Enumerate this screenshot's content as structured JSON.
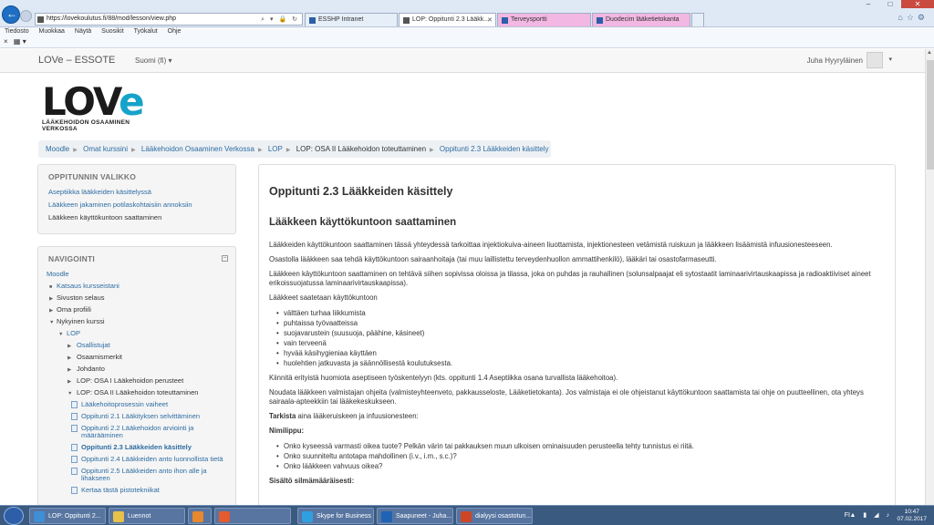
{
  "browser": {
    "url": "https://lovekoulutus.fi/88/mod/lesson/view.php",
    "tabs": [
      {
        "label": "ESSHP Intranet"
      },
      {
        "label": "LOP: Oppitunti 2.3 Lääkk..."
      },
      {
        "label": "Terveysportti"
      },
      {
        "label": "Duodecim lääketietokanta"
      }
    ],
    "menu": [
      "Tiedosto",
      "Muokkaa",
      "Näytä",
      "Suosikit",
      "Työkalut",
      "Ohje"
    ]
  },
  "colors": {
    "accent": "#2d6ca2",
    "logo_e": "#16a3c9",
    "tab_pink": "#f2b7e2"
  },
  "site": {
    "brand": "LOVe – ESSOTE",
    "language": "Suomi (fi)",
    "user": "Juha Hyyryläinen",
    "logo_word": "LOV",
    "logo_e": "e",
    "logo_sub": "LÄÄKEHOIDON OSAAMINEN VERKOSSA"
  },
  "breadcrumb": [
    "Moodle",
    "Omat kurssini",
    "Lääkehoidon Osaaminen Verkossa",
    "LOP",
    "LOP: OSA II Lääkehoidon toteuttaminen",
    "Oppitunti 2.3 Lääkkeiden käsittely"
  ],
  "lesson_menu": {
    "title": "OPPITUNNIN VALIKKO",
    "items": [
      "Aseptiikka lääkkeiden käsittelyssä",
      "Lääkkeen jakaminen potilaskohtaisiin annoksiin",
      "Lääkkeen käyttökuntoon saattaminen"
    ]
  },
  "navigation": {
    "title": "NAVIGOINTI",
    "items": [
      "Moodle",
      "Katsaus kursseistani",
      "Sivuston selaus",
      "Oma profiili",
      "Nykyinen kurssi",
      "LOP",
      "Osallistujat",
      "Osaamismerkit",
      "Johdanto",
      "LOP: OSA I Lääkehoidon perusteet",
      "LOP: OSA II Lääkehoidon toteuttaminen",
      "Lääkehoitoprosessin vaiheet",
      "Oppitunti 2.1 Lääkityksen selvittäminen",
      "Oppitunti 2.2 Lääkehoidon arviointi ja määrääminen",
      "Oppitunti 2.3 Lääkkeiden käsittely",
      "Oppitunti 2.4 Lääkkeiden anto luonnollista tietä",
      "Oppitunti 2.5 Lääkkeiden anto ihon alle ja lihakseen",
      "Kertaa tästä pistotekniikat"
    ]
  },
  "content": {
    "title": "Oppitunti 2.3 Lääkkeiden käsittely",
    "subtitle": "Lääkkeen käyttökuntoon saattaminen",
    "p1": "Lääkkeiden käyttökuntoon saattaminen tässä yhteydessä tarkoittaa injektiokuiva-aineen liuottamista, injektionesteen vetämistä ruiskuun ja lääkkeen lisäämistä infuusionesteeseen.",
    "p2": "Osastolla lääkkeen saa tehdä käyttökuntoon sairaanhoitaja (tai muu laillistettu terveydenhuollon ammattihenkilö), lääkäri tai osastofarmaseutti.",
    "p3": "Lääkkeen käyttökuntoon saattaminen on tehtävä siihen sopivissa oloissa ja tilassa, joka on puhdas ja rauhallinen (solunsalpaajat eli sytostaatit laminaarivirtauskaapissa ja radioaktiiviset aineet erikoissuojatussa laminaarivirtauskaapissa).",
    "p4": "Lääkkeet saatetaan käyttökuntoon",
    "list1": [
      "välttäen turhaa liikkumista",
      "puhtaissa työvaatteissa",
      "suojavarustein (suusuoja, päähine, käsineet)",
      "vain terveenä",
      "hyvää käsihygieniaa käyttäen",
      "huolehtien jatkuvasta ja säännöllisestä koulutuksesta."
    ],
    "p5": "Kiinnitä erityistä huomiota aseptiseen työskentelyyn (kts. oppitunti 1.4 Aseptiikka osana turvallista lääkehoitoa).",
    "p6": "Noudata lääkkeen valmistajan ohjeita (valmisteyhteenveto, pakkausseloste, Lääketietokanta). Jos valmistaja ei ole ohjeistanut käyttökuntoon saattamista tai ohje on puutteellinen, ota yhteys sairaala-apteekkiin tai lääkekeskukseen.",
    "check_bold": "Tarkista",
    "check_rest": " aina lääkeruiskeen ja infuusionesteen:",
    "label_name": "Nimilippu:",
    "list2": [
      "Onko kyseessä varmasti oikea tuote? Pelkän värin tai pakkauksen muun ulkoisen ominaisuuden perusteella tehty tunnistus ei riitä.",
      "Onko suunniteltu antotapa mahdollinen (i.v., i.m., s.c.)?",
      "Onko lääkkeen vahvuus oikea?"
    ],
    "label_contents": "Sisältö silmämääräisesti:"
  },
  "taskbar": {
    "items": [
      "LOP: Oppitunti 2...",
      "Luennot",
      "",
      "",
      "Skype for Business",
      "Saapuneet - Juha...",
      "dialyysi osastotun..."
    ],
    "lang": "FI",
    "time": "10:47",
    "date": "07.02.2017"
  }
}
